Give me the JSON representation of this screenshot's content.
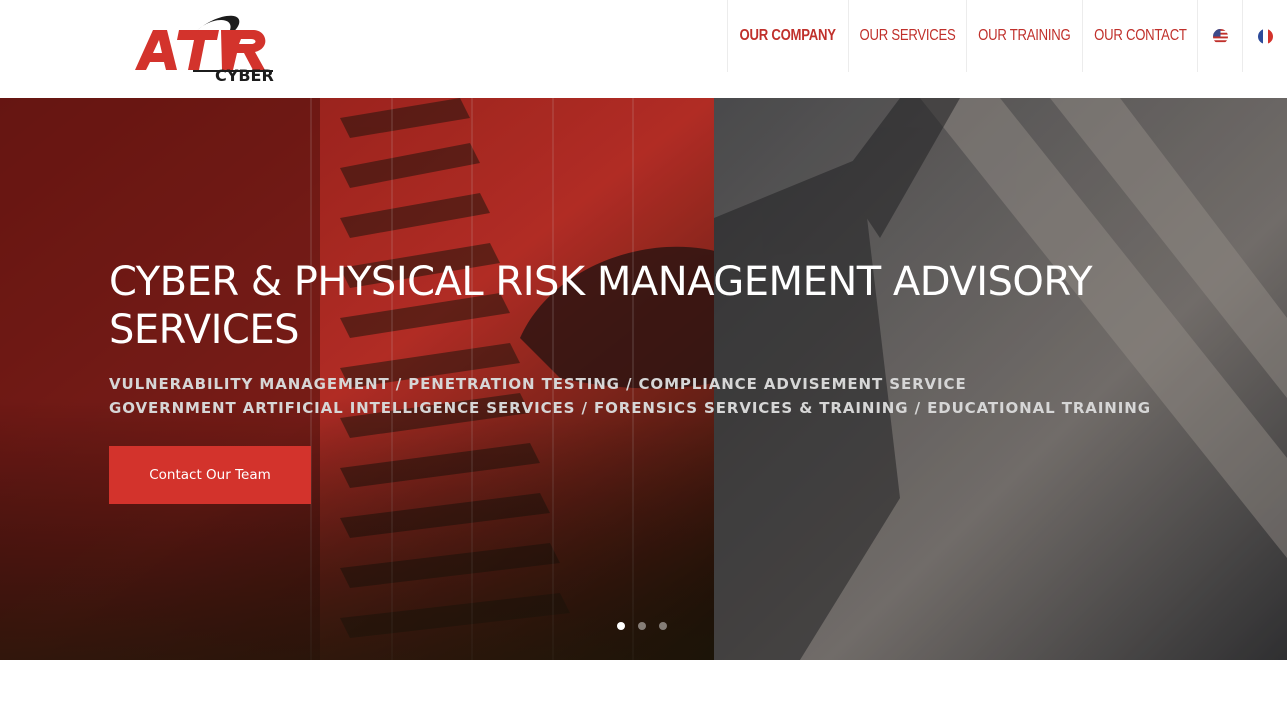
{
  "header": {
    "logo_text": "ATR",
    "logo_subtext": "CYBER",
    "nav": [
      {
        "label": "OUR COMPANY",
        "active": true
      },
      {
        "label": "OUR SERVICES",
        "active": false
      },
      {
        "label": "OUR TRAINING",
        "active": false
      },
      {
        "label": "OUR CONTACT",
        "active": false
      }
    ],
    "languages": [
      {
        "icon": "us-flag-icon"
      },
      {
        "icon": "france-flag-icon"
      }
    ]
  },
  "hero": {
    "title_line1": "CYBER & PHYSICAL RISK MANAGEMENT ADVISORY",
    "title_line2": "SERVICES",
    "subtitle_line1": "VULNERABILITY MANAGEMENT / PENETRATION TESTING / COMPLIANCE ADVISEMENT SERVICE",
    "subtitle_line2": "GOVERNMENT ARTIFICIAL INTELLIGENCE SERVICES / FORENSICS SERVICES & TRAINING / EDUCATIONAL TRAINING",
    "cta_label": "Contact Our Team",
    "slides": 3,
    "active_slide": 1
  },
  "colors": {
    "brand_red": "#d3332c",
    "nav_red": "#c0302b",
    "dark_grey": "#222222"
  }
}
